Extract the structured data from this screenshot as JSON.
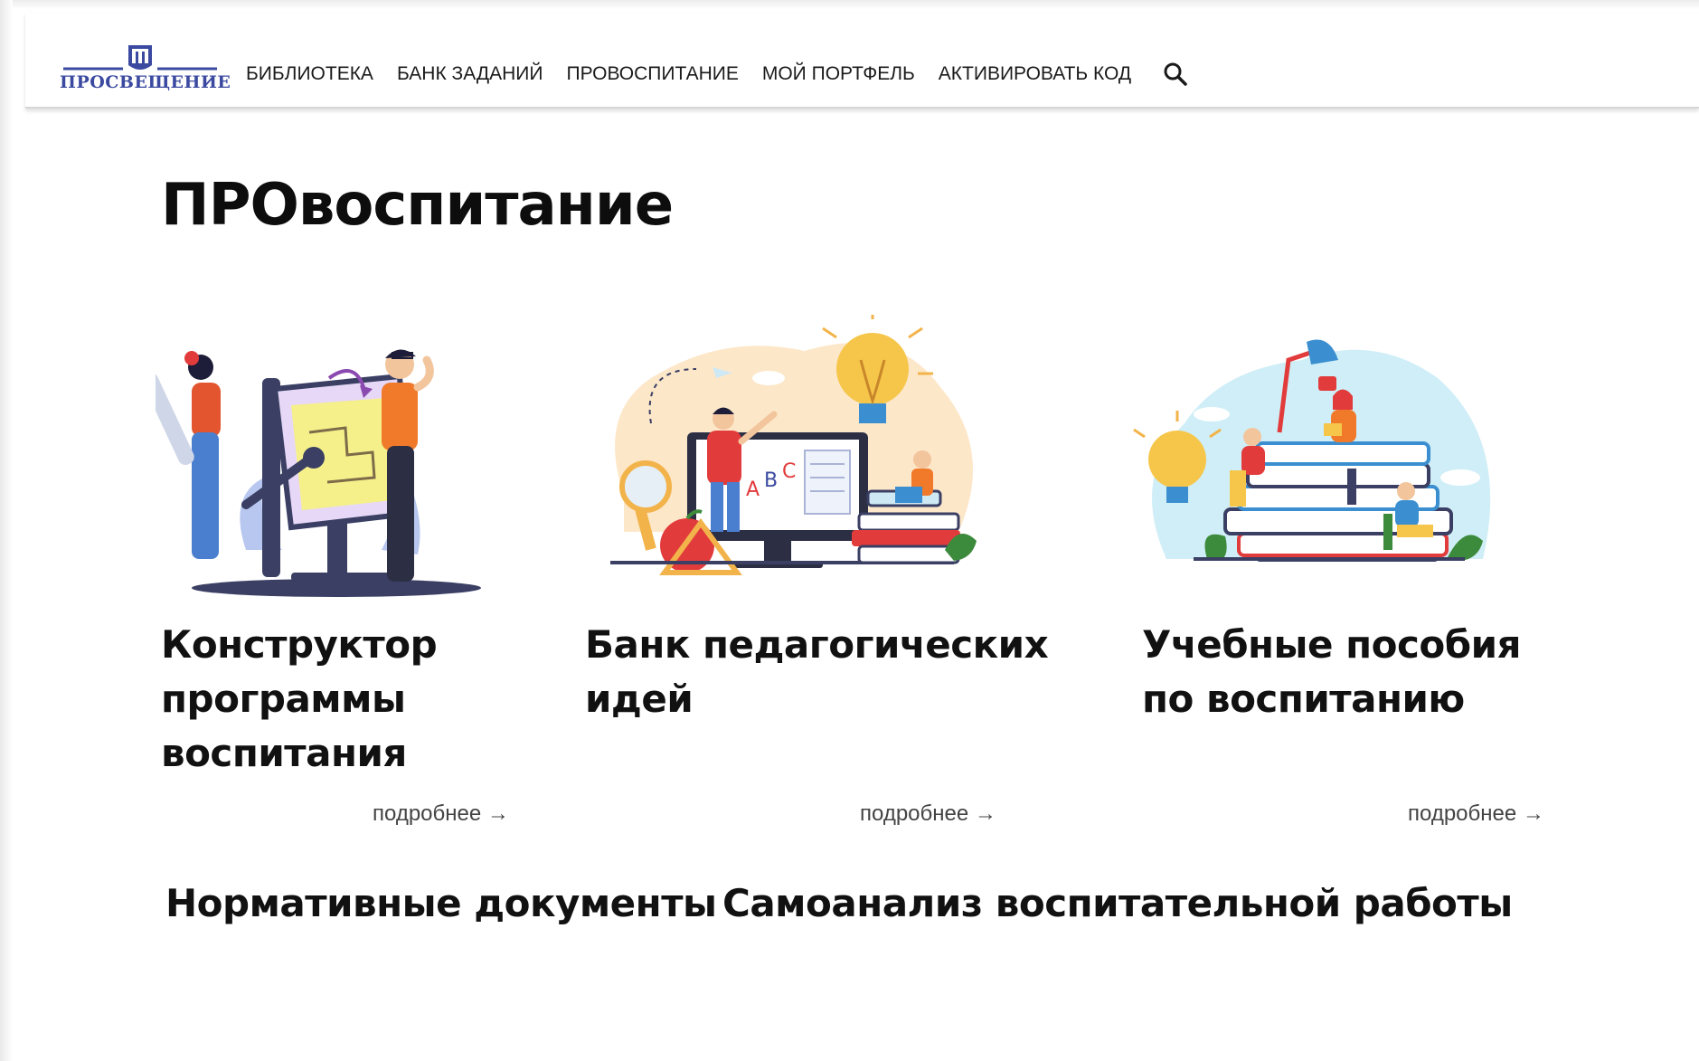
{
  "brand": {
    "name": "ПРОСВЕЩЕНИЕ",
    "color": "#3b4aa0"
  },
  "nav": {
    "items": [
      {
        "label": "БИБЛИОТЕКА"
      },
      {
        "label": "БАНК ЗАДАНИЙ"
      },
      {
        "label": "ПРОВОСПИТАНИЕ"
      },
      {
        "label": "МОЙ ПОРТФЕЛЬ"
      },
      {
        "label": "АКТИВИРОВАТЬ КОД"
      }
    ],
    "search_icon": "search-icon"
  },
  "page": {
    "title": "ПРОвоспитание"
  },
  "cards": [
    {
      "title_lines": [
        "Конструктор",
        "программы",
        "воспитания"
      ],
      "illustration": "drafting-board-people-illustration",
      "more_label": "подробнее →"
    },
    {
      "title_lines": [
        "Банк педагогических",
        "идей"
      ],
      "illustration": "teacher-monitor-lightbulb-illustration",
      "more_label": "подробнее →"
    },
    {
      "title_lines": [
        "Учебные пособия",
        "по воспитанию"
      ],
      "illustration": "books-stack-readers-illustration",
      "more_label": "подробнее →"
    }
  ],
  "sections": [
    {
      "title": "Нормативные документы"
    },
    {
      "title": "Самоанализ воспитательной работы"
    }
  ],
  "colors": {
    "accent_orange": "#f07a2a",
    "accent_red": "#e23b3b",
    "accent_blue": "#3b4aa0",
    "illustration_sky": "#cfeef7",
    "illustration_peach": "#fde7c9"
  }
}
